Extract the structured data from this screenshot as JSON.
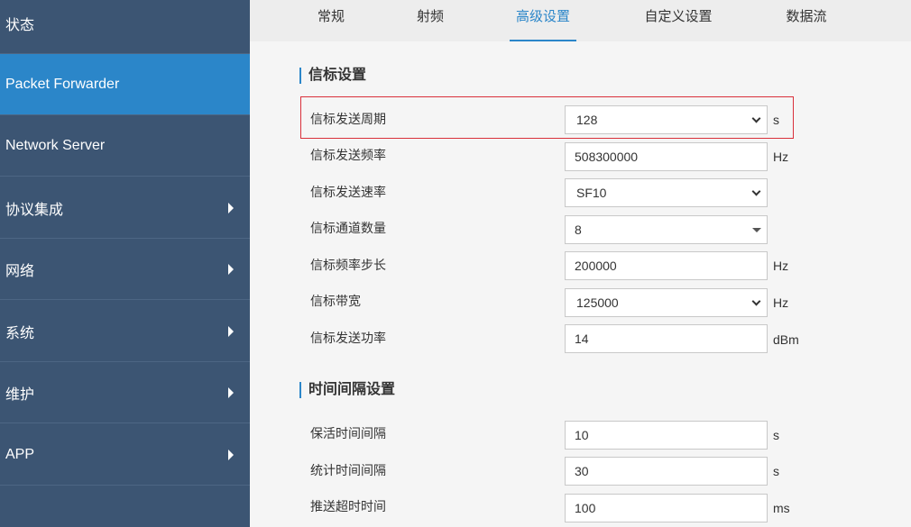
{
  "sidebar": {
    "items": [
      {
        "label": "状态",
        "expandable": false
      },
      {
        "label": "Packet Forwarder",
        "expandable": false,
        "active": true
      },
      {
        "label": "Network Server",
        "expandable": false
      },
      {
        "label": "协议集成",
        "expandable": true
      },
      {
        "label": "网络",
        "expandable": true
      },
      {
        "label": "系统",
        "expandable": true
      },
      {
        "label": "维护",
        "expandable": true
      },
      {
        "label": "APP",
        "expandable": true
      }
    ]
  },
  "tabs": [
    {
      "label": "常规"
    },
    {
      "label": "射频"
    },
    {
      "label": "高级设置",
      "active": true
    },
    {
      "label": "自定义设置"
    },
    {
      "label": "数据流"
    }
  ],
  "beacon": {
    "title": "信标设置",
    "rows": [
      {
        "label": "信标发送周期",
        "value": "128",
        "type": "select",
        "unit": "s",
        "highlighted": true
      },
      {
        "label": "信标发送频率",
        "value": "508300000",
        "type": "input",
        "unit": "Hz"
      },
      {
        "label": "信标发送速率",
        "value": "SF10",
        "type": "select",
        "unit": ""
      },
      {
        "label": "信标通道数量",
        "value": "8",
        "type": "combo",
        "unit": ""
      },
      {
        "label": "信标频率步长",
        "value": "200000",
        "type": "input",
        "unit": "Hz"
      },
      {
        "label": "信标带宽",
        "value": "125000",
        "type": "select",
        "unit": "Hz"
      },
      {
        "label": "信标发送功率",
        "value": "14",
        "type": "input",
        "unit": "dBm"
      }
    ]
  },
  "interval": {
    "title": "时间间隔设置",
    "rows": [
      {
        "label": "保活时间间隔",
        "value": "10",
        "type": "input",
        "unit": "s"
      },
      {
        "label": "统计时间间隔",
        "value": "30",
        "type": "input",
        "unit": "s"
      },
      {
        "label": "推送超时时间",
        "value": "100",
        "type": "input",
        "unit": "ms"
      }
    ]
  },
  "colors": {
    "sidebar_bg": "#3c5573",
    "sidebar_active": "#2b86c9",
    "accent": "#2b86c9",
    "highlight_border": "#d9303a"
  }
}
